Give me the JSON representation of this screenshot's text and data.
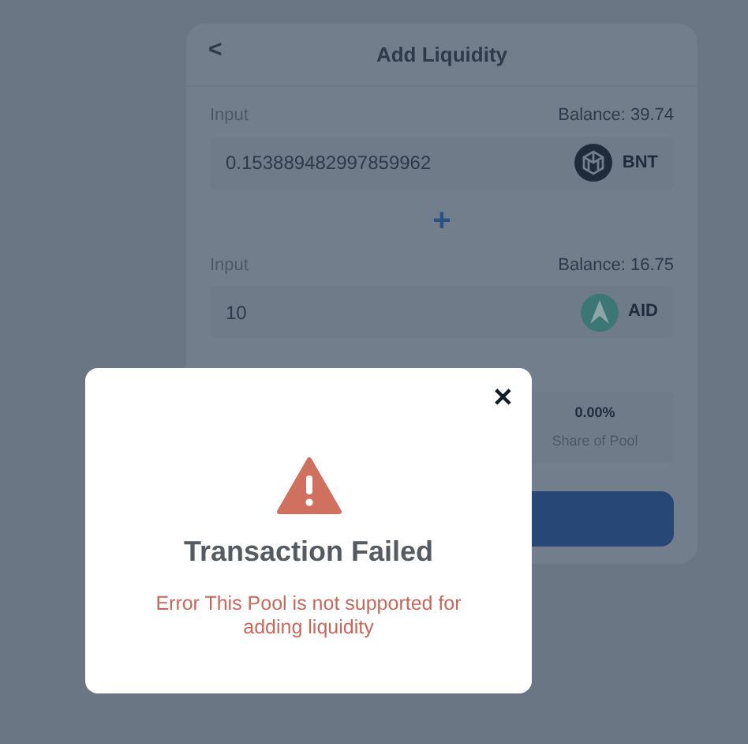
{
  "card": {
    "title": "Add Liquidity",
    "back": "<",
    "inputs": [
      {
        "label": "Input",
        "balance": "Balance: 39.74",
        "value": "0.153889482997859962",
        "token": "BNT",
        "kind": "bnt"
      },
      {
        "label": "Input",
        "balance": "Balance: 16.75",
        "value": "10",
        "token": "AID",
        "kind": "aid"
      }
    ],
    "plus": "+",
    "share": {
      "value": "0.00%",
      "label": "Share of Pool"
    }
  },
  "modal": {
    "close": "✕",
    "title": "Transaction Failed",
    "message": "Error This Pool is not supported for adding liquidity"
  }
}
